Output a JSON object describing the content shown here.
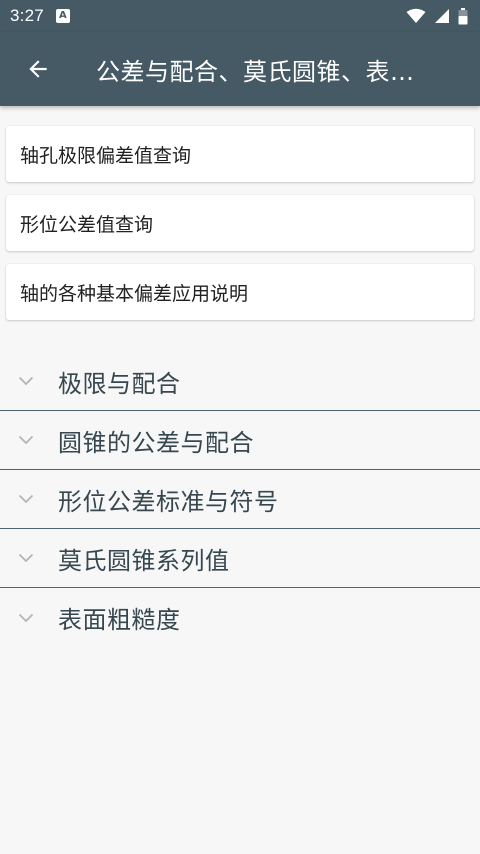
{
  "status_bar": {
    "time": "3:27",
    "app_icon_letter": "A",
    "icons": [
      "wifi-icon",
      "signal-icon",
      "battery-icon"
    ]
  },
  "app_bar": {
    "title": "公差与配合、莫氏圆锥、表…",
    "back_icon": "arrow-left-icon"
  },
  "cards": [
    {
      "label": "轴孔极限偏差值查询"
    },
    {
      "label": "形位公差值查询"
    },
    {
      "label": "轴的各种基本偏差应用说明"
    }
  ],
  "sections": [
    {
      "label": "极限与配合"
    },
    {
      "label": "圆锥的公差与配合"
    },
    {
      "label": "形位公差标准与符号"
    },
    {
      "label": "莫氏圆锥系列值"
    },
    {
      "label": "表面粗糙度"
    }
  ],
  "colors": {
    "app_bar": "#455a64",
    "background": "#f7f7f7",
    "section_text": "#37474f",
    "divider": "#4f6470",
    "chevron": "#b0b6b9"
  }
}
